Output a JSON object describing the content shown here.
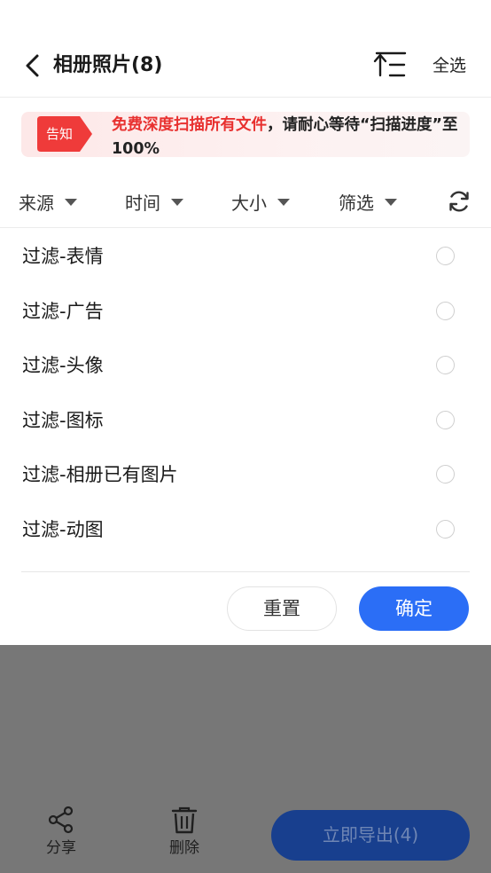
{
  "header": {
    "title": "相册照片(8)",
    "select_all": "全选",
    "back_icon": "chevron-left-icon",
    "sort_icon": "sort-icon"
  },
  "notice": {
    "tag": "告知",
    "highlight": "免费深度扫描所有文件",
    "message": "，请耐心等待“扫描进度”至100%"
  },
  "filters": {
    "tabs": [
      "来源",
      "时间",
      "大小",
      "筛选"
    ],
    "refresh_icon": "refresh-icon"
  },
  "options": [
    {
      "label": "过滤-表情",
      "checked": false
    },
    {
      "label": "过滤-广告",
      "checked": false
    },
    {
      "label": "过滤-头像",
      "checked": false
    },
    {
      "label": "过滤-图标",
      "checked": false
    },
    {
      "label": "过滤-相册已有图片",
      "checked": false
    },
    {
      "label": "过滤-动图",
      "checked": false
    }
  ],
  "actions": {
    "reset": "重置",
    "confirm": "确定"
  },
  "bottom_bar": {
    "share": "分享",
    "delete": "删除",
    "export": "立即导出(4)"
  },
  "colors": {
    "accent": "#2b6ef6",
    "notice_red": "#e8302f",
    "overlay": "#777777"
  }
}
